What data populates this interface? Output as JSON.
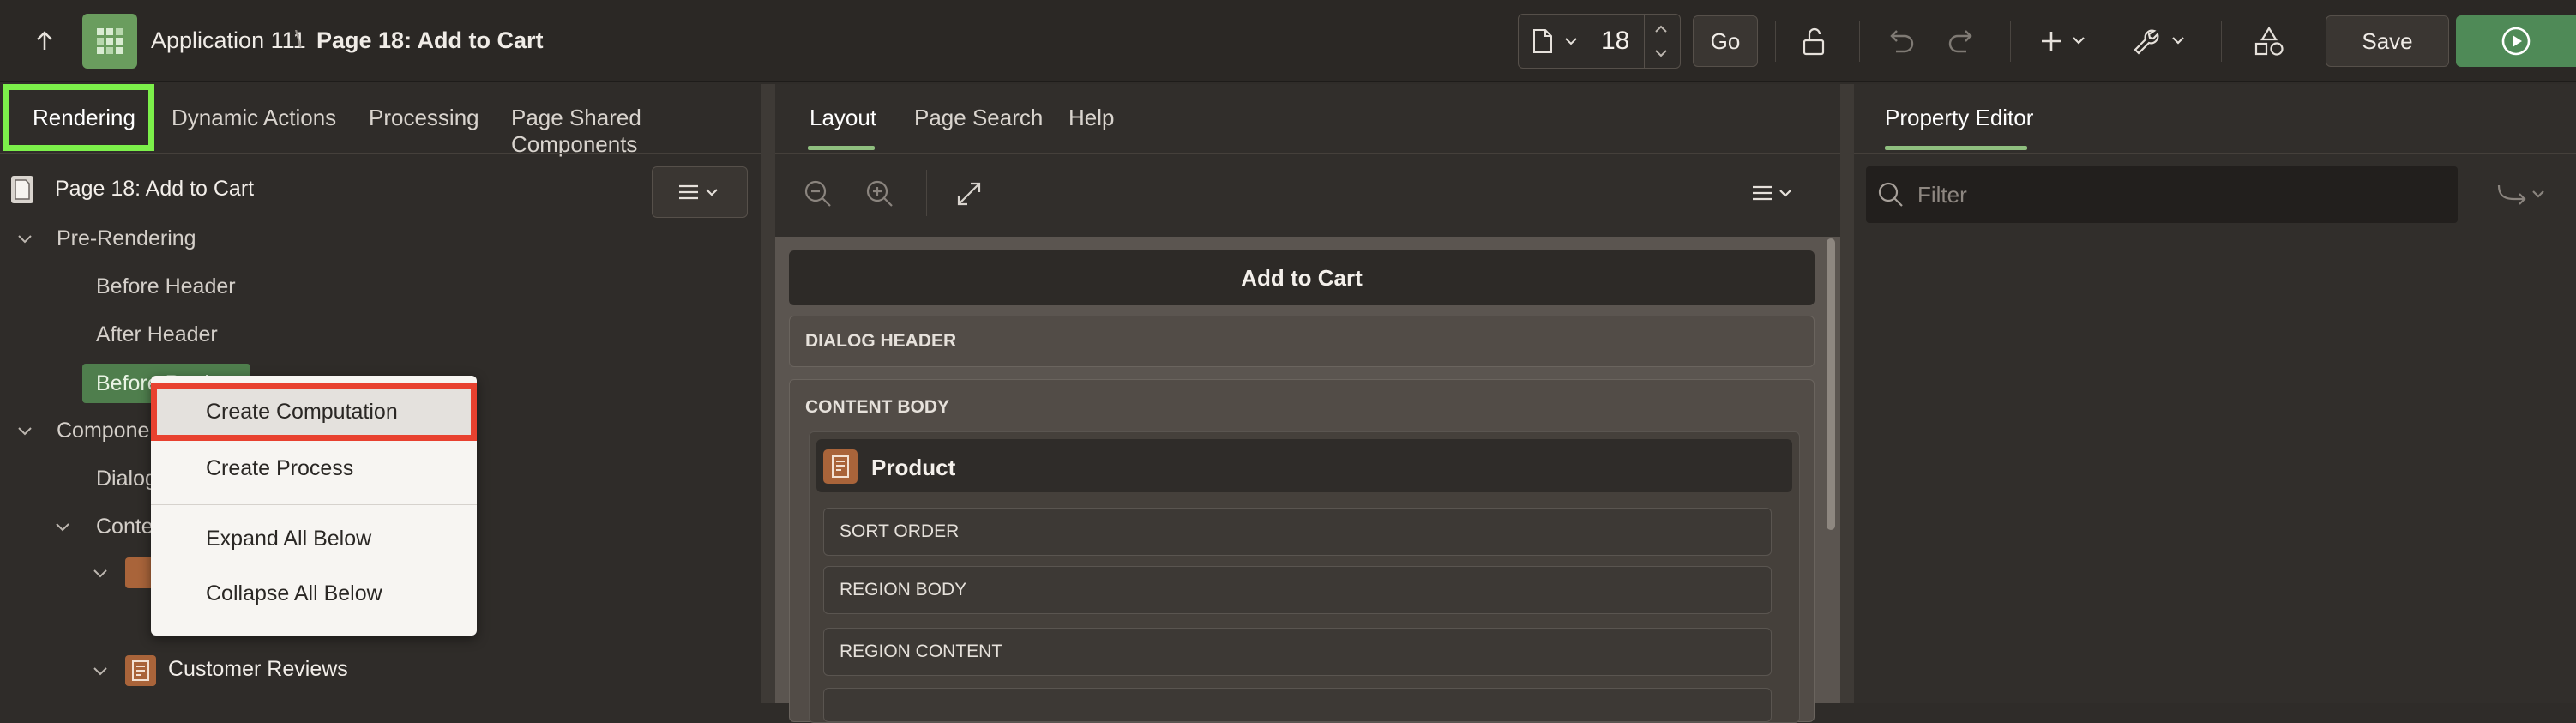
{
  "header": {
    "app_name": "Application 111",
    "separator": "\\",
    "page_title": "Page 18: Add to Cart",
    "page_number_value": "18",
    "go_label": "Go",
    "save_label": "Save"
  },
  "left_panel": {
    "tabs": [
      "Rendering",
      "Dynamic Actions",
      "Processing",
      "Page Shared Components"
    ],
    "page_node": "Page 18: Add to Cart",
    "tree": {
      "pre_rendering": "Pre-Rendering",
      "before_header": "Before Header",
      "after_header": "After Header",
      "before_regions": "Before Regions",
      "components": "Components",
      "dialog_header": "Dialog Header",
      "content_body": "Content Body",
      "customer_reviews": "Customer Reviews"
    }
  },
  "context_menu": {
    "items": [
      "Create Computation",
      "Create Process",
      "Expand All Below",
      "Collapse All Below"
    ]
  },
  "middle_panel": {
    "tabs": [
      "Layout",
      "Page Search",
      "Help"
    ],
    "dialog_title": "Add to Cart",
    "dialog_header": "DIALOG HEADER",
    "content_body": "CONTENT BODY",
    "region_title": "Product",
    "slots": [
      "SORT ORDER",
      "REGION BODY",
      "REGION CONTENT"
    ]
  },
  "right_panel": {
    "tab": "Property Editor",
    "filter_placeholder": "Filter"
  },
  "colors": {
    "accent_green": "#8fbf7f",
    "run_button": "#4f8a57",
    "highlight_box": "#7cf04a",
    "selection_box": "#e8412f"
  }
}
